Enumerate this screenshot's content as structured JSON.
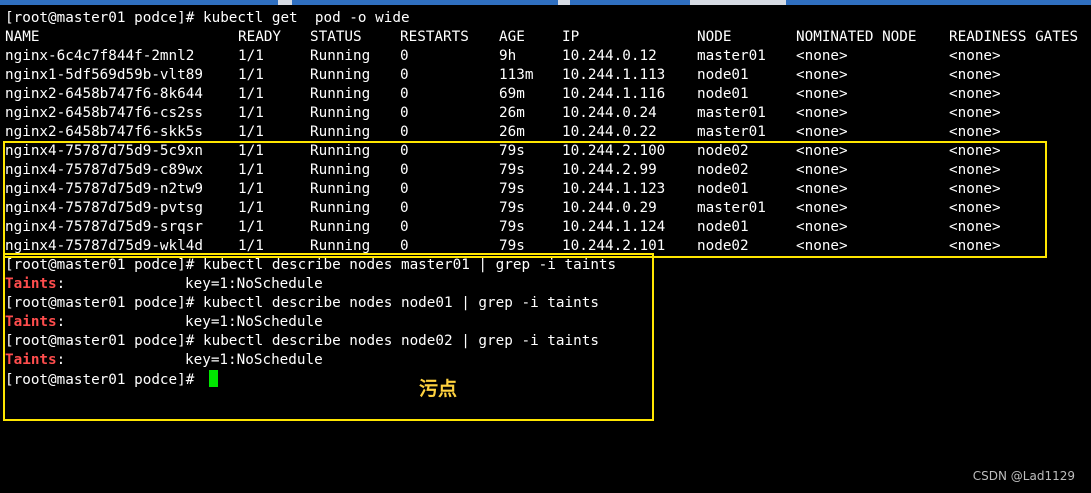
{
  "terminal": {
    "prompt": "[root@master01 podce]# ",
    "commands": {
      "get_pods": "kubectl get  pod -o wide",
      "describe_master01": "kubectl describe nodes master01 | grep -i taints",
      "describe_node01": "kubectl describe nodes node01 | grep -i taints",
      "describe_node02": "kubectl describe nodes node02 | grep -i taints"
    },
    "table": {
      "headers": [
        "NAME",
        "READY",
        "STATUS",
        "RESTARTS",
        "AGE",
        "IP",
        "NODE",
        "NOMINATED NODE",
        "READINESS GATES"
      ],
      "rows": [
        [
          "nginx-6c4c7f844f-2mnl2",
          "1/1",
          "Running",
          "0",
          "9h",
          "10.244.0.12",
          "master01",
          "<none>",
          "<none>"
        ],
        [
          "nginx1-5df569d59b-vlt89",
          "1/1",
          "Running",
          "0",
          "113m",
          "10.244.1.113",
          "node01",
          "<none>",
          "<none>"
        ],
        [
          "nginx2-6458b747f6-8k644",
          "1/1",
          "Running",
          "0",
          "69m",
          "10.244.1.116",
          "node01",
          "<none>",
          "<none>"
        ],
        [
          "nginx2-6458b747f6-cs2ss",
          "1/1",
          "Running",
          "0",
          "26m",
          "10.244.0.24",
          "master01",
          "<none>",
          "<none>"
        ],
        [
          "nginx2-6458b747f6-skk5s",
          "1/1",
          "Running",
          "0",
          "26m",
          "10.244.0.22",
          "master01",
          "<none>",
          "<none>"
        ],
        [
          "nginx4-75787d75d9-5c9xn",
          "1/1",
          "Running",
          "0",
          "79s",
          "10.244.2.100",
          "node02",
          "<none>",
          "<none>"
        ],
        [
          "nginx4-75787d75d9-c89wx",
          "1/1",
          "Running",
          "0",
          "79s",
          "10.244.2.99",
          "node02",
          "<none>",
          "<none>"
        ],
        [
          "nginx4-75787d75d9-n2tw9",
          "1/1",
          "Running",
          "0",
          "79s",
          "10.244.1.123",
          "node01",
          "<none>",
          "<none>"
        ],
        [
          "nginx4-75787d75d9-pvtsg",
          "1/1",
          "Running",
          "0",
          "79s",
          "10.244.0.29",
          "master01",
          "<none>",
          "<none>"
        ],
        [
          "nginx4-75787d75d9-srqsr",
          "1/1",
          "Running",
          "0",
          "79s",
          "10.244.1.124",
          "node01",
          "<none>",
          "<none>"
        ],
        [
          "nginx4-75787d75d9-wkl4d",
          "1/1",
          "Running",
          "0",
          "79s",
          "10.244.2.101",
          "node02",
          "<none>",
          "<none>"
        ]
      ]
    },
    "taints_label": "Taints",
    "taints_colon": ":",
    "taints_value": "key=1:NoSchedule"
  },
  "annotation": "污点",
  "watermark": "CSDN @Lad1129",
  "colors": {
    "background": "#000000",
    "text": "#ffffff",
    "taints_key": "#ff4d4d",
    "highlight_border": "#ffe600",
    "annotation": "#ffd23f",
    "cursor": "#00e600"
  }
}
